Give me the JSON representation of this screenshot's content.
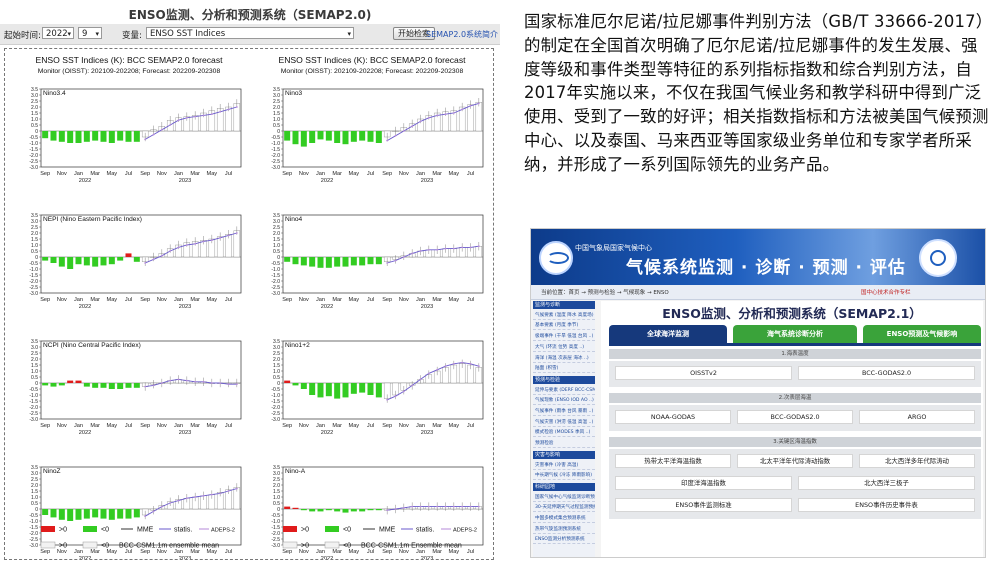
{
  "left_app": {
    "title": "ENSO监测、分析和预测系统（SEMAP2.0)",
    "controls": {
      "start_label": "起始时间:",
      "year": "2022",
      "month": "9",
      "variable_label": "变量:",
      "variable": "ENSO SST Indices",
      "start_button": "开始检索",
      "intro_link": "SEMAP2.0系统简介"
    },
    "figure": {
      "columns": [
        {
          "title": "ENSO SST Indices (K): BCC SEMAP2.0 forecast",
          "subtitle": "Monitor (OISST): 202109-202208; Forecast: 202209-202308"
        },
        {
          "title": "ENSO SST Indices (K): BCC SEMAP2.0 forecast",
          "subtitle": "Monitor (OISST): 202109-202208; Forecast: 202209-202308"
        }
      ],
      "month_labels": [
        "Sep",
        "Nov",
        "Jan",
        "Mar",
        "May",
        "Jul",
        "Sep",
        "Nov",
        "Jan",
        "Mar",
        "May",
        "Jul"
      ],
      "year_labels": [
        "2022",
        "2023"
      ],
      "y_ticks": [
        "3.5",
        "3.0",
        "2.5",
        "2.0",
        "1.5",
        "1.0",
        "0.5",
        "0",
        "-0.5",
        "-1.0",
        "-1.5",
        "-2.0",
        "-2.5",
        "-3.0"
      ],
      "legend": {
        "obs_pos": ">0",
        "obs_neg": "<0",
        "mme": "MME",
        "statis": "statis.",
        "adeps": "ADEPS-2",
        "fc_pos": ">0",
        "fc_neg": "<0",
        "ensemble": "BCC-CSM1.1m ensemble mean",
        "ensemble_alt": "BCC-CSM1.1m Ensemble mean"
      },
      "colors": {
        "obs_pos": "#e01b1b",
        "obs_neg": "#33cc22",
        "forecast_bar": "#ffffff",
        "mme_line": "#333333",
        "statis_line": "#6a5acd",
        "adeps_line": "#b48ad8"
      }
    }
  },
  "chart_data": [
    {
      "type": "bar",
      "title": "Nino3.4",
      "ylim": [
        -3.0,
        3.5
      ],
      "x": [
        "Sep",
        "Oct",
        "Nov",
        "Dec",
        "Jan",
        "Feb",
        "Mar",
        "Apr",
        "May",
        "Jun",
        "Jul",
        "Aug",
        "Sep",
        "Oct",
        "Nov",
        "Dec",
        "Jan",
        "Feb",
        "Mar",
        "Apr",
        "May",
        "Jun",
        "Jul",
        "Aug"
      ],
      "observed": [
        -0.6,
        -0.8,
        -0.9,
        -1.0,
        -1.0,
        -0.9,
        -0.8,
        -0.9,
        -1.0,
        -0.8,
        -0.9,
        -0.9
      ],
      "forecast": [
        -0.5,
        0.1,
        0.4,
        0.9,
        1.1,
        1.2,
        1.3,
        1.5,
        1.7,
        1.9,
        2.0,
        2.3
      ],
      "mme": [
        -0.7,
        -0.3,
        0.1,
        0.5,
        0.9,
        1.1,
        1.2,
        1.3,
        1.4,
        1.6,
        1.8,
        2.0
      ]
    },
    {
      "type": "bar",
      "title": "Nino3",
      "ylim": [
        -3.0,
        3.5
      ],
      "x": [
        "Sep",
        "Oct",
        "Nov",
        "Dec",
        "Jan",
        "Feb",
        "Mar",
        "Apr",
        "May",
        "Jun",
        "Jul",
        "Aug",
        "Sep",
        "Oct",
        "Nov",
        "Dec",
        "Jan",
        "Feb",
        "Mar",
        "Apr",
        "May",
        "Jun",
        "Jul",
        "Aug"
      ],
      "observed": [
        -0.8,
        -1.1,
        -1.3,
        -1.0,
        -0.7,
        -0.8,
        -1.0,
        -1.1,
        -0.9,
        -0.8,
        -0.9,
        -1.0
      ],
      "forecast": [
        -0.5,
        0.0,
        0.3,
        0.6,
        1.0,
        1.3,
        1.5,
        1.6,
        1.7,
        2.0,
        2.2,
        2.4
      ],
      "mme": [
        -0.8,
        -0.4,
        0.0,
        0.4,
        0.8,
        1.1,
        1.3,
        1.4,
        1.5,
        1.8,
        2.1,
        2.3
      ]
    },
    {
      "type": "bar",
      "title": "NEPI (Nino Eastern Pacific Index)",
      "ylim": [
        -3.0,
        3.5
      ],
      "x": [
        "Sep",
        "Oct",
        "Nov",
        "Dec",
        "Jan",
        "Feb",
        "Mar",
        "Apr",
        "May",
        "Jun",
        "Jul",
        "Aug",
        "Sep",
        "Oct",
        "Nov",
        "Dec",
        "Jan",
        "Feb",
        "Mar",
        "Apr",
        "May",
        "Jun",
        "Jul",
        "Aug"
      ],
      "observed": [
        -0.3,
        -0.5,
        -0.8,
        -1.0,
        -0.6,
        -0.7,
        -0.8,
        -0.7,
        -0.6,
        -0.3,
        0.3,
        -0.4
      ],
      "forecast": [
        -0.4,
        0.0,
        0.3,
        0.7,
        1.0,
        1.2,
        1.3,
        1.4,
        1.5,
        1.7,
        1.9,
        2.2
      ],
      "mme": [
        -0.5,
        -0.2,
        0.1,
        0.5,
        0.8,
        1.0,
        1.1,
        1.3,
        1.4,
        1.6,
        1.8,
        2.0
      ]
    },
    {
      "type": "bar",
      "title": "Nino4",
      "ylim": [
        -3.0,
        3.5
      ],
      "x": [
        "Sep",
        "Oct",
        "Nov",
        "Dec",
        "Jan",
        "Feb",
        "Mar",
        "Apr",
        "May",
        "Jun",
        "Jul",
        "Aug",
        "Sep",
        "Oct",
        "Nov",
        "Dec",
        "Jan",
        "Feb",
        "Mar",
        "Apr",
        "May",
        "Jun",
        "Jul",
        "Aug"
      ],
      "observed": [
        -0.4,
        -0.6,
        -0.7,
        -0.8,
        -0.9,
        -0.9,
        -0.8,
        -0.8,
        -0.7,
        -0.7,
        -0.6,
        -0.6
      ],
      "forecast": [
        -0.4,
        -0.2,
        0.1,
        0.3,
        0.5,
        0.6,
        0.6,
        0.7,
        0.7,
        0.8,
        0.8,
        0.9
      ],
      "mme": [
        -0.5,
        -0.3,
        0.0,
        0.3,
        0.5,
        0.6,
        0.6,
        0.7,
        0.7,
        0.8,
        0.8,
        0.9
      ]
    },
    {
      "type": "bar",
      "title": "NCPI (Nino Central Pacific Index)",
      "ylim": [
        -3.0,
        3.5
      ],
      "x": [
        "Sep",
        "Oct",
        "Nov",
        "Dec",
        "Jan",
        "Feb",
        "Mar",
        "Apr",
        "May",
        "Jun",
        "Jul",
        "Aug",
        "Sep",
        "Oct",
        "Nov",
        "Dec",
        "Jan",
        "Feb",
        "Mar",
        "Apr",
        "May",
        "Jun",
        "Jul",
        "Aug"
      ],
      "observed": [
        -0.2,
        -0.3,
        -0.2,
        0.2,
        0.2,
        -0.3,
        -0.4,
        -0.4,
        -0.5,
        -0.5,
        -0.4,
        -0.4
      ],
      "forecast": [
        -0.3,
        -0.1,
        0.0,
        0.2,
        0.3,
        0.2,
        0.1,
        0.1,
        0.0,
        0.0,
        0.0,
        0.0
      ],
      "mme": [
        -0.3,
        -0.2,
        0.0,
        0.2,
        0.3,
        0.2,
        0.1,
        0.1,
        0.0,
        0.0,
        -0.1,
        -0.1
      ]
    },
    {
      "type": "bar",
      "title": "Nino1+2",
      "ylim": [
        -3.0,
        3.5
      ],
      "x": [
        "Sep",
        "Oct",
        "Nov",
        "Dec",
        "Jan",
        "Feb",
        "Mar",
        "Apr",
        "May",
        "Jun",
        "Jul",
        "Aug",
        "Sep",
        "Oct",
        "Nov",
        "Dec",
        "Jan",
        "Feb",
        "Mar",
        "Apr",
        "May",
        "Jun",
        "Jul",
        "Aug"
      ],
      "observed": [
        0.2,
        -0.2,
        -0.5,
        -1.0,
        -1.2,
        -1.1,
        -1.3,
        -1.2,
        -0.9,
        -0.8,
        -1.0,
        -1.2
      ],
      "forecast": [
        -1.3,
        -1.0,
        -0.6,
        -0.2,
        0.3,
        0.7,
        1.0,
        1.3,
        1.5,
        1.6,
        1.5,
        1.3
      ],
      "mme": [
        -1.4,
        -1.1,
        -0.7,
        -0.2,
        0.3,
        0.8,
        1.1,
        1.4,
        1.6,
        1.7,
        1.6,
        1.4
      ]
    },
    {
      "type": "bar",
      "title": "NinoZ",
      "ylim": [
        -3.0,
        3.5
      ],
      "x": [
        "Sep",
        "Oct",
        "Nov",
        "Dec",
        "Jan",
        "Feb",
        "Mar",
        "Apr",
        "May",
        "Jun",
        "Jul",
        "Aug",
        "Sep",
        "Oct",
        "Nov",
        "Dec",
        "Jan",
        "Feb",
        "Mar",
        "Apr",
        "May",
        "Jun",
        "Jul",
        "Aug"
      ],
      "observed": [
        -0.5,
        -0.7,
        -0.9,
        -1.0,
        -0.9,
        -0.8,
        -0.7,
        -0.8,
        -0.9,
        -0.8,
        -0.8,
        -0.7
      ],
      "forecast": [
        -0.5,
        -0.1,
        0.3,
        0.6,
        0.8,
        0.9,
        1.0,
        1.1,
        1.2,
        1.4,
        1.6,
        1.8
      ],
      "mme": [
        -0.6,
        -0.2,
        0.2,
        0.5,
        0.7,
        0.9,
        1.0,
        1.1,
        1.2,
        1.3,
        1.5,
        1.7
      ]
    },
    {
      "type": "bar",
      "title": "Nino-A",
      "ylim": [
        -3.0,
        3.5
      ],
      "x": [
        "Sep",
        "Oct",
        "Nov",
        "Dec",
        "Jan",
        "Feb",
        "Mar",
        "Apr",
        "May",
        "Jun",
        "Jul",
        "Aug",
        "Sep",
        "Oct",
        "Nov",
        "Dec",
        "Jan",
        "Feb",
        "Mar",
        "Apr",
        "May",
        "Jun",
        "Jul",
        "Aug"
      ],
      "observed": [
        0.2,
        0.1,
        -0.1,
        -0.2,
        -0.2,
        -0.1,
        -0.2,
        -0.3,
        -0.2,
        -0.2,
        -0.1,
        -0.1
      ],
      "forecast": [
        -0.1,
        0.0,
        0.1,
        0.2,
        0.2,
        0.2,
        0.2,
        0.2,
        0.2,
        0.2,
        0.2,
        0.2
      ],
      "mme": [
        -0.1,
        0.0,
        0.1,
        0.2,
        0.2,
        0.2,
        0.2,
        0.2,
        0.2,
        0.2,
        0.2,
        0.2
      ]
    }
  ],
  "description": "国家标准厄尔尼诺/拉尼娜事件判别方法（GB/T 33666-2017）的制定在全国首次明确了厄尔尼诺/拉尼娜事件的发生发展、强度等级和事件类型等特征的系列指标指数和综合判别方法，自2017年实施以来，不仅在我国气候业务和教学科研中得到广泛使用、受到了一致的好评；相关指数指标和方法被美国气候预测中心、以及泰国、马来西亚等国家级业务单位和专家学者所采纳，并形成了一系列国际领先的业务产品。",
  "site": {
    "org": "中国气象局国家气候中心",
    "slogan": "气候系统监测 · 诊断 · 预测 · 评估",
    "breadcrumb": "当前位置：首页 → 预测与检验 → 气候现象 → ENSO",
    "notice": "国中心技术合作专栏",
    "main_title": "ENSO监测、分析和预测系统（SEMAP2.1）",
    "tabs": [
      {
        "label": "全球海洋监测",
        "color": "#16397c"
      },
      {
        "label": "海气系统诊断分析",
        "color": "#3aa33a"
      },
      {
        "label": "ENSO预测及气候影响",
        "color": "#3aa33a"
      }
    ],
    "sections": [
      {
        "title": "1.海表温度",
        "rows": [
          [
            "OISSTv2",
            "BCC-GODAS2.0"
          ]
        ]
      },
      {
        "title": "2.次表层海温",
        "rows": [
          [
            "NOAA-GODAS",
            "BCC-GODAS2.0",
            "ARGO"
          ]
        ]
      },
      {
        "title": "3.关键区海温指数",
        "rows": [
          [
            "热带太平洋海温指数",
            "北太平洋年代际涛动指数",
            "北大西洋多年代际涛动"
          ],
          [
            "印度洋海温指数",
            "北大西洋三极子"
          ],
          [
            "ENSO事件监测标准",
            "ENSO事件历史事件表"
          ]
        ]
      }
    ],
    "sidebar": [
      {
        "header": "监测与诊断"
      },
      {
        "item": "气候要素 (温度 降水 高度场)"
      },
      {
        "item": "基本要素 (月度 季节)"
      },
      {
        "item": "极端事件 (干旱 低温 台风 ..)"
      },
      {
        "item": "大气 (环流 位势 高度 ..)"
      },
      {
        "item": "海洋 (海温 次表层 海冰 ..)"
      },
      {
        "item": "陆面 (积雪)"
      },
      {
        "header": "预测与检验"
      },
      {
        "item": "延伸与要素 (DERF BCC-CSM)"
      },
      {
        "item": "气候现象 (ENSO IOD AO ..)"
      },
      {
        "item": "气候事件 (雨季 台风 暴雨 ..)"
      },
      {
        "item": "气候灾害 (洪涝 低温 高温 ..)"
      },
      {
        "item": "模式检验 (MODES 季风 ..)"
      },
      {
        "item": "预测检验"
      },
      {
        "header": "灾害与影响"
      },
      {
        "item": "灾害事件 (冷害 高温)"
      },
      {
        "item": "中长期气候 (冷冻 降雨影响)"
      },
      {
        "header": "科研园地"
      },
      {
        "item": "国家气候中心气候监测诊断预测系统"
      },
      {
        "item": "30-天延伸期天气过程监测预报"
      },
      {
        "item": "中国多模式集合预测系统"
      },
      {
        "item": "热带气旋监测预测系统"
      },
      {
        "item": "ENSO监测分析预测系统"
      }
    ]
  }
}
